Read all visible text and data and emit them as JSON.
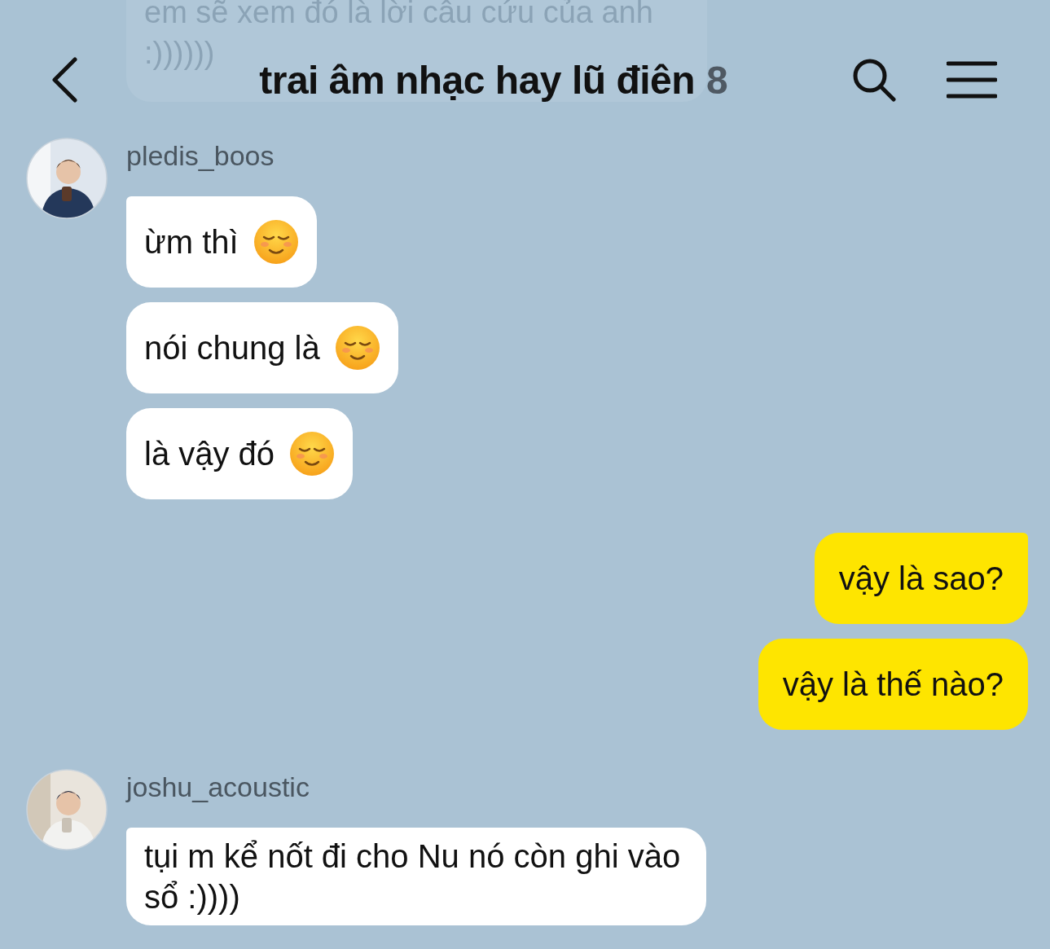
{
  "previous_message": {
    "text": "em sẽ xem đó là lời câu cứu của anh :))))))"
  },
  "header": {
    "title": "trai âm nhạc hay lũ điên",
    "member_count": "8"
  },
  "groups": [
    {
      "kind": "incoming",
      "sender": "pledis_boos",
      "messages": [
        {
          "text": "ừm thì",
          "emoji": true
        },
        {
          "text": "nói chung là",
          "emoji": true
        },
        {
          "text": "là vậy đó",
          "emoji": true
        }
      ]
    },
    {
      "kind": "outgoing",
      "messages": [
        {
          "text": "vậy là sao?",
          "emoji": false
        },
        {
          "text": "vậy là thế nào?",
          "emoji": false
        }
      ]
    },
    {
      "kind": "incoming",
      "sender": "joshu_acoustic",
      "messages": [
        {
          "text": "tụi m kể nốt đi cho Nu nó còn ghi vào sổ :))))",
          "emoji": false
        }
      ]
    }
  ]
}
